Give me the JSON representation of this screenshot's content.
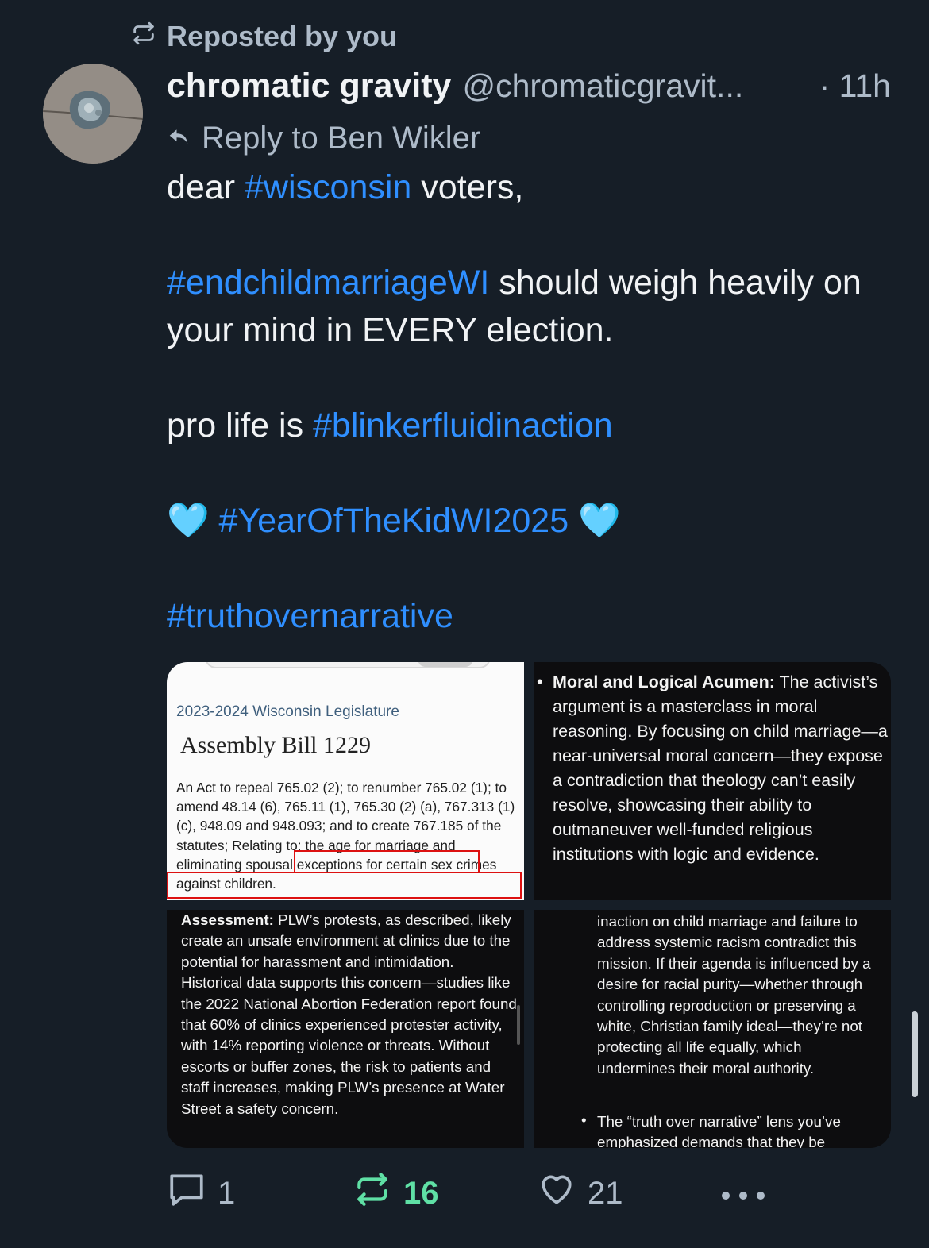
{
  "repost_banner": {
    "label": "Reposted by you",
    "icon": "repost-icon"
  },
  "post": {
    "author": {
      "display_name": "chromatic gravity",
      "handle": "@chromaticgravit...",
      "avatar_icon": "avatar-image"
    },
    "timestamp": "· 11h",
    "reply_to": {
      "label": "Reply to Ben Wikler",
      "icon": "reply-arrow-icon"
    },
    "text": {
      "line1_pre": "dear ",
      "line1_tag": "#wisconsin",
      "line1_post": " voters,",
      "para2_tag": "#endchildmarriageWI",
      "para2_post": " should weigh heavily on your mind in EVERY election.",
      "para3_pre": "pro life is ",
      "para3_tag": "#blinkerfluidinaction",
      "para4_heart": "🩵",
      "para4_tag": "#YearOfTheKidWI2025",
      "para5_tag": "#truthovernarrative"
    },
    "images": {
      "img1": {
        "legislature": "2023-2024 Wisconsin Legislature",
        "bill_title": "Assembly Bill 1229",
        "bill_text": "An Act to repeal 765.02 (2); to renumber 765.02 (1); to amend 48.14 (6), 765.11 (1), 765.30 (2) (a), 767.313 (1) (c), 948.09 and 948.093; and to create 767.185 of the statutes; Relating to: the age for marriage and eliminating spousal exceptions for certain sex crimes against children."
      },
      "img2": {
        "bold": "Moral and Logical Acumen:",
        "text": " The activist’s argument is a masterclass in moral reasoning. By focusing on child marriage—a near-universal moral concern—they expose a contradiction that theology can’t easily resolve, showcasing their ability to outmaneuver well-funded religious institutions with logic and evidence."
      },
      "img3": {
        "bold": "Assessment:",
        "text": " PLW’s protests, as described, likely create an unsafe environment at clinics due to the potential for harassment and intimidation. Historical data supports this concern—studies like the 2022 National Abortion Federation report found that 60% of clinics experienced protester activity, with 14% reporting violence or threats. Without escorts or buffer zones, the risk to patients and staff increases, making PLW’s presence at Water Street a safety concern."
      },
      "img4": {
        "text": "inaction on child marriage and failure to address systemic racism contradict this mission. If their agenda is influenced by a desire for racial purity—whether through controlling reproduction or preserving a white, Christian family ideal—they’re not protecting all life equally, which undermines their moral authority.",
        "bullet_text": "The “truth over narrative” lens you’ve emphasized demands that they be"
      }
    },
    "actions": {
      "reply": {
        "icon": "comment-icon",
        "count": "1"
      },
      "repost": {
        "icon": "repost-icon",
        "count": "16",
        "active_color": "#5fe0a5"
      },
      "like": {
        "icon": "heart-icon",
        "count": "21"
      },
      "more": {
        "icon": "more-dots-icon"
      }
    }
  },
  "colors": {
    "background": "#161e27",
    "link": "#2f8fff",
    "muted": "#aebbc9"
  }
}
